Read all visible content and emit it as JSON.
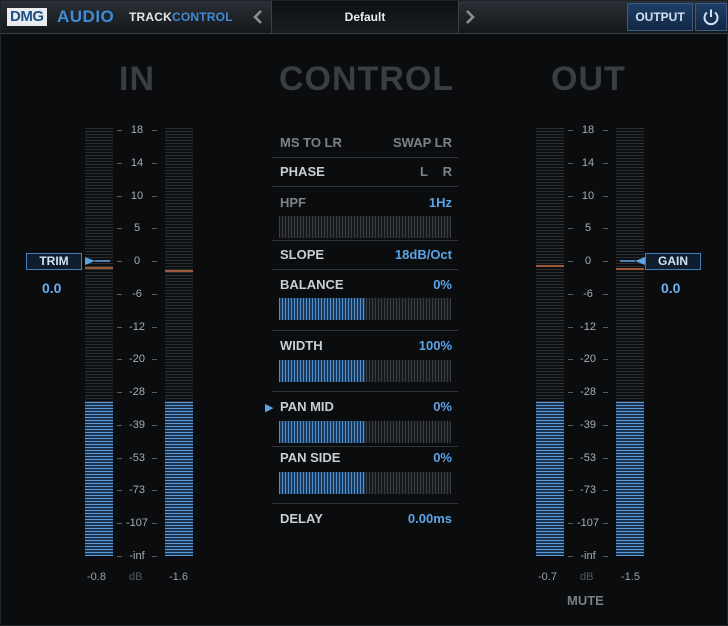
{
  "header": {
    "brand_dmg": "DMG",
    "brand_audio": "AUDIO",
    "product_a": "TRACK",
    "product_b": "CONTROL",
    "preset_name": "Default",
    "prev_icon": "chevron-left-icon",
    "next_icon": "chevron-right-icon",
    "output_label": "OUTPUT",
    "power_icon": "power-icon"
  },
  "sections": {
    "in": "IN",
    "control": "CONTROL",
    "out": "OUT"
  },
  "scale_ticks": [
    "18",
    "14",
    "10",
    "5",
    "0",
    "-6",
    "-12",
    "-20",
    "-28",
    "-39",
    "-53",
    "-73",
    "-107",
    "-inf"
  ],
  "input": {
    "trim_label": "TRIM",
    "trim_value": "0.0",
    "peak_left": "-0.8",
    "peak_right": "-1.6",
    "unit": "dB",
    "level_left": 0.36,
    "level_right": 0.36
  },
  "output": {
    "gain_label": "GAIN",
    "gain_value": "0.0",
    "peak_left": "-0.7",
    "peak_right": "-1.5",
    "unit": "dB",
    "mute_label": "MUTE",
    "level_left": 0.36,
    "level_right": 0.36
  },
  "control": {
    "ms_to_lr": "MS TO LR",
    "swap_lr": "SWAP LR",
    "phase": "PHASE",
    "phase_l": "L",
    "phase_r": "R",
    "hpf": "HPF",
    "hpf_value": "1",
    "hpf_unit": "Hz",
    "slope": "SLOPE",
    "slope_value": "18",
    "slope_unit": "dB/Oct",
    "balance": "BALANCE",
    "balance_value": "0%",
    "balance_level": 0.5,
    "width": "WIDTH",
    "width_value": "100%",
    "width_level": 0.5,
    "pan_mid": "PAN MID",
    "pan_mid_value": "0%",
    "pan_mid_level": 0.5,
    "pan_side": "PAN SIDE",
    "pan_side_value": "0%",
    "pan_side_level": 0.5,
    "delay": "DELAY",
    "delay_value": "0.00",
    "delay_unit": "ms"
  }
}
